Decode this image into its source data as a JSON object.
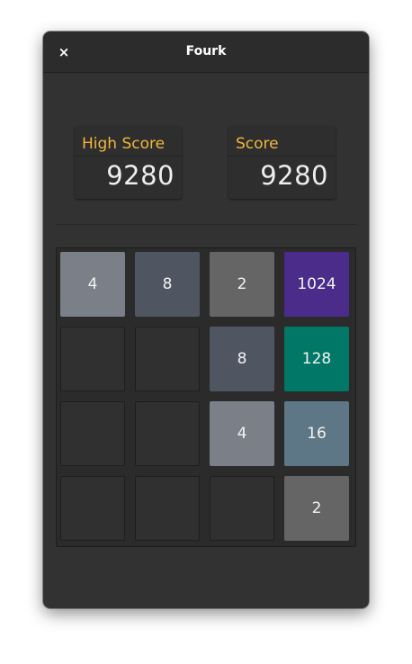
{
  "window": {
    "title": "Fourk",
    "close_glyph": "×"
  },
  "scores": {
    "high_label": "High Score",
    "high_value": "9280",
    "score_label": "Score",
    "score_value": "9280"
  },
  "board": {
    "rows": [
      [
        "4",
        "8",
        "2",
        "1024"
      ],
      [
        "",
        "",
        "8",
        "128"
      ],
      [
        "",
        "",
        "4",
        "16"
      ],
      [
        "",
        "",
        "",
        "2"
      ]
    ]
  },
  "tile_colors": {
    "2": "#656565",
    "4": "#7b7f88",
    "8": "#505661",
    "16": "#5d7787",
    "128": "#017767",
    "1024": "#4b2c8a"
  }
}
